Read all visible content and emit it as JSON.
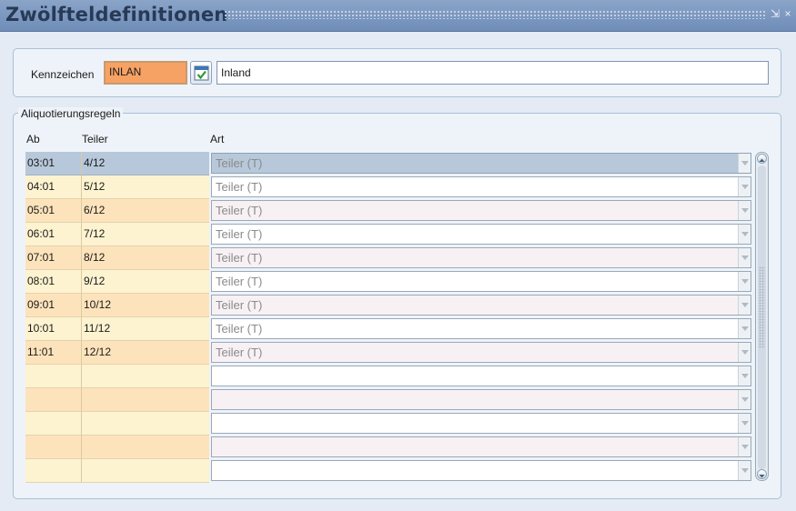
{
  "window": {
    "title": "Zwölfteldefinitionen",
    "minimize_glyph": "⇲",
    "close_glyph": "×"
  },
  "header_form": {
    "kennzeichen_label": "Kennzeichen",
    "kennzeichen_value": "INLAN",
    "lookup_icon": "calendar-check-icon",
    "description_value": "Inland"
  },
  "rules_group": {
    "legend": "Aliquotierungsregeln",
    "columns": {
      "ab": "Ab",
      "teiler": "Teiler",
      "art": "Art"
    },
    "rows": [
      {
        "ab": "03:01",
        "teiler": "4/12",
        "art": "Teiler (T)"
      },
      {
        "ab": "04:01",
        "teiler": "5/12",
        "art": "Teiler (T)"
      },
      {
        "ab": "05:01",
        "teiler": "6/12",
        "art": "Teiler (T)"
      },
      {
        "ab": "06:01",
        "teiler": "7/12",
        "art": "Teiler (T)"
      },
      {
        "ab": "07:01",
        "teiler": "8/12",
        "art": "Teiler (T)"
      },
      {
        "ab": "08:01",
        "teiler": "9/12",
        "art": "Teiler (T)"
      },
      {
        "ab": "09:01",
        "teiler": "10/12",
        "art": "Teiler (T)"
      },
      {
        "ab": "10:01",
        "teiler": "11/12",
        "art": "Teiler (T)"
      },
      {
        "ab": "11:01",
        "teiler": "12/12",
        "art": "Teiler (T)"
      },
      {
        "ab": "",
        "teiler": "",
        "art": ""
      },
      {
        "ab": "",
        "teiler": "",
        "art": ""
      },
      {
        "ab": "",
        "teiler": "",
        "art": ""
      },
      {
        "ab": "",
        "teiler": "",
        "art": ""
      },
      {
        "ab": "",
        "teiler": "",
        "art": ""
      }
    ]
  },
  "colors": {
    "titlebar": "#7a96bf",
    "code_field": "#f6a264",
    "row_odd": "#fde3bb",
    "row_even": "#fef3d0",
    "row_selected": "#b7c8da"
  }
}
